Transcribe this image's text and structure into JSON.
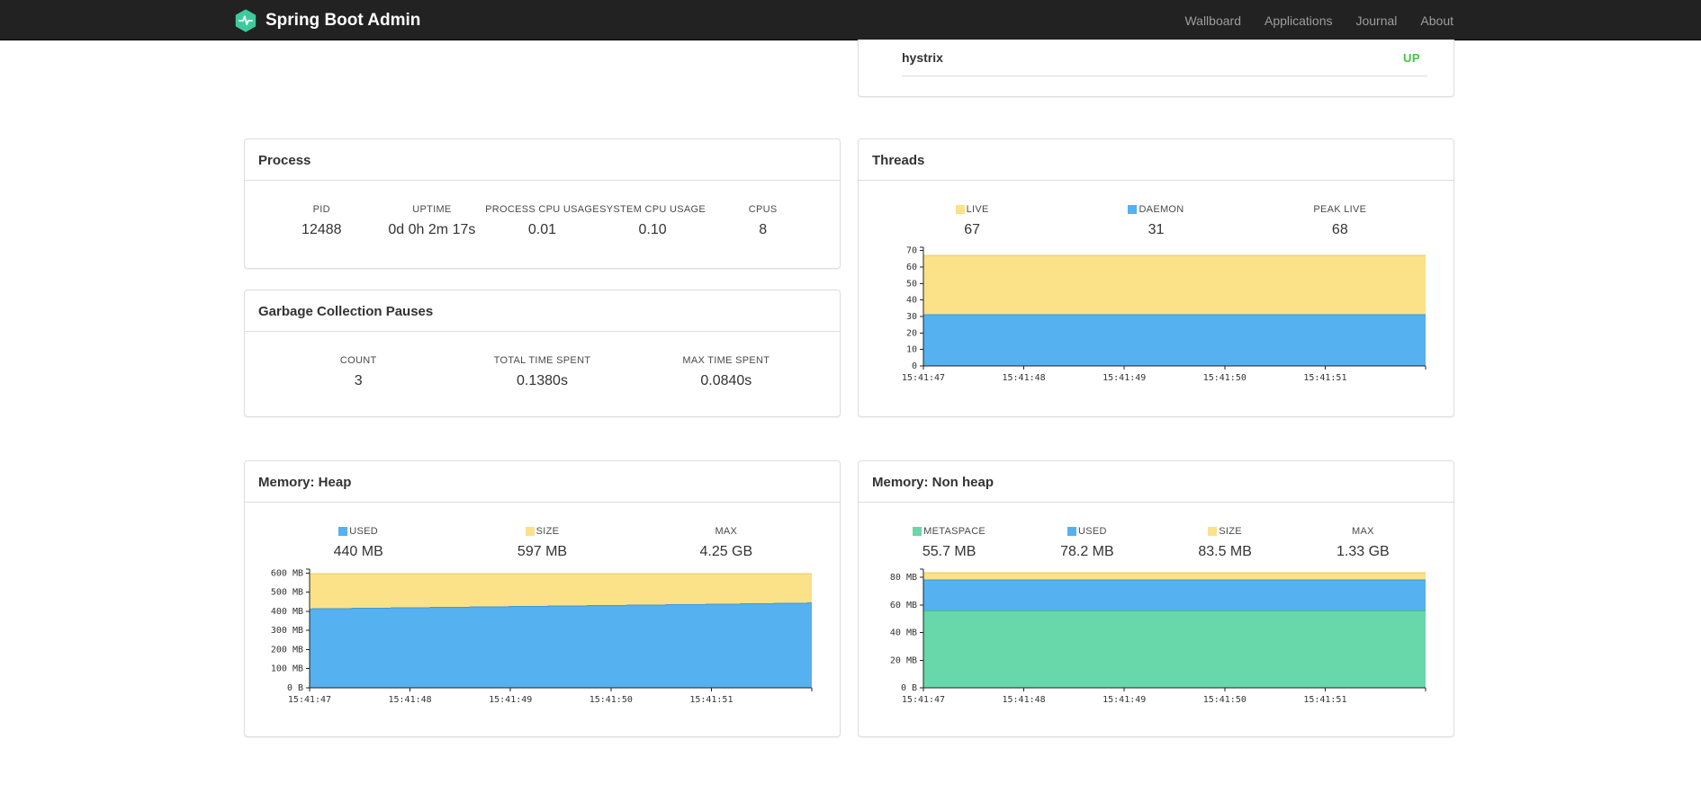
{
  "navbar": {
    "brand": "Spring Boot Admin",
    "links": [
      "Wallboard",
      "Applications",
      "Journal",
      "About"
    ]
  },
  "application_panel": {
    "name": "hystrix",
    "status": "UP",
    "status_color": "#43C543"
  },
  "panels": {
    "process": {
      "title": "Process",
      "metrics": [
        {
          "label": "PID",
          "value": "12488"
        },
        {
          "label": "UPTIME",
          "value": "0d 0h 2m 17s"
        },
        {
          "label": "PROCESS CPU USAGE",
          "value": "0.01"
        },
        {
          "label": "SYSTEM CPU USAGE",
          "value": "0.10"
        },
        {
          "label": "CPUS",
          "value": "8"
        }
      ]
    },
    "gc": {
      "title": "Garbage Collection Pauses",
      "metrics": [
        {
          "label": "COUNT",
          "value": "3"
        },
        {
          "label": "TOTAL TIME SPENT",
          "value": "0.1380s"
        },
        {
          "label": "MAX TIME SPENT",
          "value": "0.0840s"
        }
      ]
    },
    "threads": {
      "title": "Threads",
      "legend": [
        {
          "label": "LIVE",
          "value": "67",
          "color": "#FBE187"
        },
        {
          "label": "DAEMON",
          "value": "31",
          "color": "#55B1F0"
        },
        {
          "label": "PEAK LIVE",
          "value": "68"
        }
      ]
    },
    "heap": {
      "title": "Memory: Heap",
      "legend": [
        {
          "label": "USED",
          "value": "440 MB",
          "color": "#55B1F0"
        },
        {
          "label": "SIZE",
          "value": "597 MB",
          "color": "#FBE187"
        },
        {
          "label": "MAX",
          "value": "4.25 GB"
        }
      ]
    },
    "nonheap": {
      "title": "Memory: Non heap",
      "legend": [
        {
          "label": "METASPACE",
          "value": "55.7 MB",
          "color": "#68D7A9"
        },
        {
          "label": "USED",
          "value": "78.2 MB",
          "color": "#55B1F0"
        },
        {
          "label": "SIZE",
          "value": "83.5 MB",
          "color": "#FBE187"
        },
        {
          "label": "MAX",
          "value": "1.33 GB"
        }
      ]
    }
  },
  "colors": {
    "accent_yellow": "#FBE187",
    "accent_blue": "#55B1F0",
    "accent_green": "#68D7A9",
    "status_up": "#43C543",
    "navbar_bg": "#222222",
    "logo_teal": "#3DCB9E",
    "panel_border": "#dddddd"
  },
  "chart_data": [
    {
      "id": "threads",
      "type": "area",
      "title": "Threads",
      "legend_position": "top",
      "grid": false,
      "x_labels": [
        "15:41:47",
        "15:41:48",
        "15:41:49",
        "15:41:50",
        "15:41:51"
      ],
      "ylim": [
        0,
        72
      ],
      "yticks": [
        {
          "v": 0,
          "label": "0"
        },
        {
          "v": 10,
          "label": "10"
        },
        {
          "v": 20,
          "label": "20"
        },
        {
          "v": 30,
          "label": "30"
        },
        {
          "v": 40,
          "label": "40"
        },
        {
          "v": 50,
          "label": "50"
        },
        {
          "v": 60,
          "label": "60"
        },
        {
          "v": 70,
          "label": "70"
        }
      ],
      "series": [
        {
          "name": "LIVE",
          "color": "#FBE187",
          "stroke": "#E9CB66",
          "values": [
            67,
            67,
            67,
            67,
            67,
            67
          ]
        },
        {
          "name": "DAEMON",
          "color": "#55B1F0",
          "stroke": "#3E98D9",
          "values": [
            31,
            31,
            31,
            31,
            31,
            31
          ]
        }
      ]
    },
    {
      "id": "heap",
      "type": "area",
      "title": "Memory: Heap",
      "legend_position": "top",
      "grid": false,
      "x_labels": [
        "15:41:47",
        "15:41:48",
        "15:41:49",
        "15:41:50",
        "15:41:51"
      ],
      "ylim": [
        0,
        620
      ],
      "yticks": [
        {
          "v": 0,
          "label": "0 B"
        },
        {
          "v": 100,
          "label": "100 MB"
        },
        {
          "v": 200,
          "label": "200 MB"
        },
        {
          "v": 300,
          "label": "300 MB"
        },
        {
          "v": 400,
          "label": "400 MB"
        },
        {
          "v": 500,
          "label": "500 MB"
        },
        {
          "v": 600,
          "label": "600 MB"
        }
      ],
      "series": [
        {
          "name": "SIZE",
          "color": "#FBE187",
          "stroke": "#E9CB66",
          "values": [
            597,
            597,
            597,
            597,
            597,
            597
          ]
        },
        {
          "name": "USED",
          "color": "#55B1F0",
          "stroke": "#3E98D9",
          "values": [
            412,
            418,
            424,
            430,
            436,
            443
          ]
        }
      ]
    },
    {
      "id": "nonheap",
      "type": "area",
      "title": "Memory: Non heap",
      "legend_position": "top",
      "grid": false,
      "x_labels": [
        "15:41:47",
        "15:41:48",
        "15:41:49",
        "15:41:50",
        "15:41:51"
      ],
      "ylim": [
        0,
        86
      ],
      "yticks": [
        {
          "v": 0,
          "label": "0 B"
        },
        {
          "v": 20,
          "label": "20 MB"
        },
        {
          "v": 40,
          "label": "40 MB"
        },
        {
          "v": 60,
          "label": "60 MB"
        },
        {
          "v": 80,
          "label": "80 MB"
        }
      ],
      "series": [
        {
          "name": "SIZE",
          "color": "#FBE187",
          "stroke": "#E9CB66",
          "values": [
            83.5,
            83.5,
            83.5,
            83.5,
            83.5,
            83.5
          ]
        },
        {
          "name": "USED",
          "color": "#55B1F0",
          "stroke": "#3E98D9",
          "values": [
            78.2,
            78.2,
            78.2,
            78.2,
            78.2,
            78.2
          ]
        },
        {
          "name": "METASPACE",
          "color": "#68D7A9",
          "stroke": "#4BBE8C",
          "values": [
            55.7,
            55.7,
            55.7,
            55.7,
            55.7,
            55.7
          ]
        }
      ]
    }
  ]
}
